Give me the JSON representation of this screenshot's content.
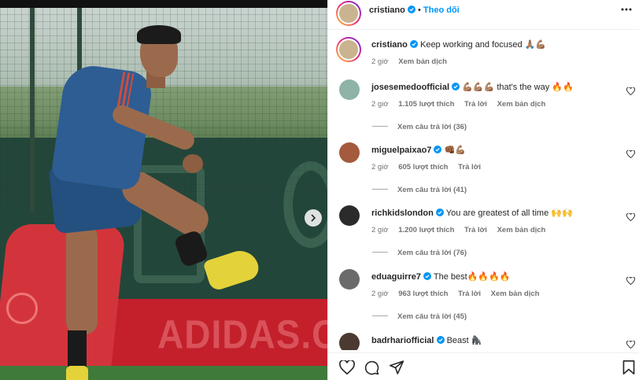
{
  "post": {
    "author": "cristiano",
    "follow_label": "Theo dõi",
    "separator": "•",
    "caption_text": "Keep working and focused 🙏🏽💪🏽",
    "caption_time": "2 giờ",
    "caption_translate": "Xem bản dịch"
  },
  "comments": [
    {
      "user": "josesemedoofficial",
      "text": "💪🏽💪🏽💪🏽 that's the way 🔥🔥",
      "time": "2 giờ",
      "likes": "1.105 lượt thích",
      "reply": "Trả lời",
      "translate": "Xem bản dịch",
      "replies": "Xem câu trả lời (36)",
      "avatar_color": "#8fb3a6"
    },
    {
      "user": "miguelpaixao7",
      "text": "👊🏾💪🏽",
      "time": "2 giờ",
      "likes": "605 lượt thích",
      "reply": "Trả lời",
      "translate": "",
      "replies": "Xem câu trả lời (41)",
      "avatar_color": "#a45a3c"
    },
    {
      "user": "richkidslondon",
      "text": "You are greatest of all time 🙌🙌",
      "time": "2 giờ",
      "likes": "1.200 lượt thích",
      "reply": "Trả lời",
      "translate": "Xem bản dịch",
      "replies": "Xem câu trả lời (76)",
      "avatar_color": "#2b2b2b"
    },
    {
      "user": "eduaguirre7",
      "text": "The best🔥🔥🔥🔥",
      "time": "2 giờ",
      "likes": "963 lượt thích",
      "reply": "Trả lời",
      "translate": "Xem bản dịch",
      "replies": "Xem câu trả lời (45)",
      "avatar_color": "#6b6b6b"
    },
    {
      "user": "badrhariofficial",
      "text": "Beast 🦍",
      "time": "",
      "likes": "",
      "reply": "",
      "translate": "",
      "replies": "",
      "avatar_color": "#4a3a30"
    }
  ],
  "media": {
    "board_text": "ADIDAS.COM"
  },
  "colors": {
    "link_blue": "#0095f6",
    "text_primary": "#262626",
    "text_secondary": "#737373"
  }
}
